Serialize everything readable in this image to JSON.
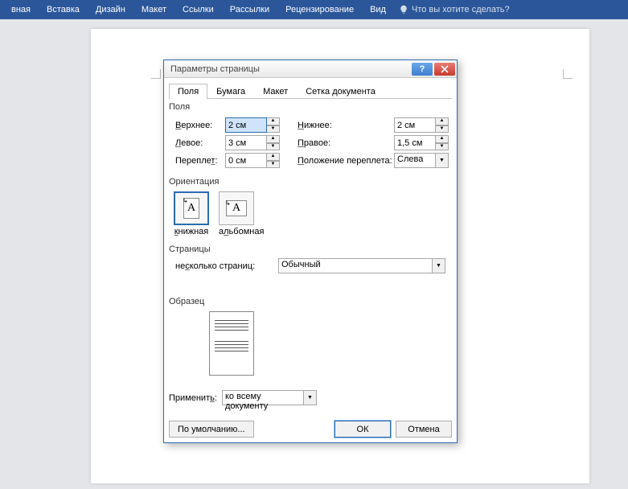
{
  "ribbon": {
    "tabs": [
      "вная",
      "Вставка",
      "Дизайн",
      "Макет",
      "Ссылки",
      "Рассылки",
      "Рецензирование",
      "Вид"
    ],
    "tellme": "Что вы хотите сделать?"
  },
  "dialog": {
    "title": "Параметры страницы",
    "tabs": {
      "t1": "Поля",
      "t2": "Бумага",
      "t3": "Макет",
      "t4": "Сетка документа"
    },
    "groups": {
      "fields": "Поля",
      "orientation": "Ориентация",
      "pages": "Страницы",
      "sample": "Образец"
    },
    "labels": {
      "top": "Верхнее:",
      "bottom": "Нижнее:",
      "left": "Левое:",
      "right": "Правое:",
      "gutter": "Переплет:",
      "gutterpos": "Положение переплета:",
      "portrait": "книжная",
      "landscape": "альбомная",
      "multipage": "несколько страниц:",
      "applyto": "Применить:",
      "default": "По умолчанию...",
      "ok": "ОК",
      "cancel": "Отмена"
    },
    "values": {
      "top": "2 см",
      "bottom": "2 см",
      "left": "3 см",
      "right": "1,5 см",
      "gutter": "0 см",
      "gutterpos": "Слева",
      "multipage": "Обычный",
      "applyto": "ко всему документу"
    }
  }
}
